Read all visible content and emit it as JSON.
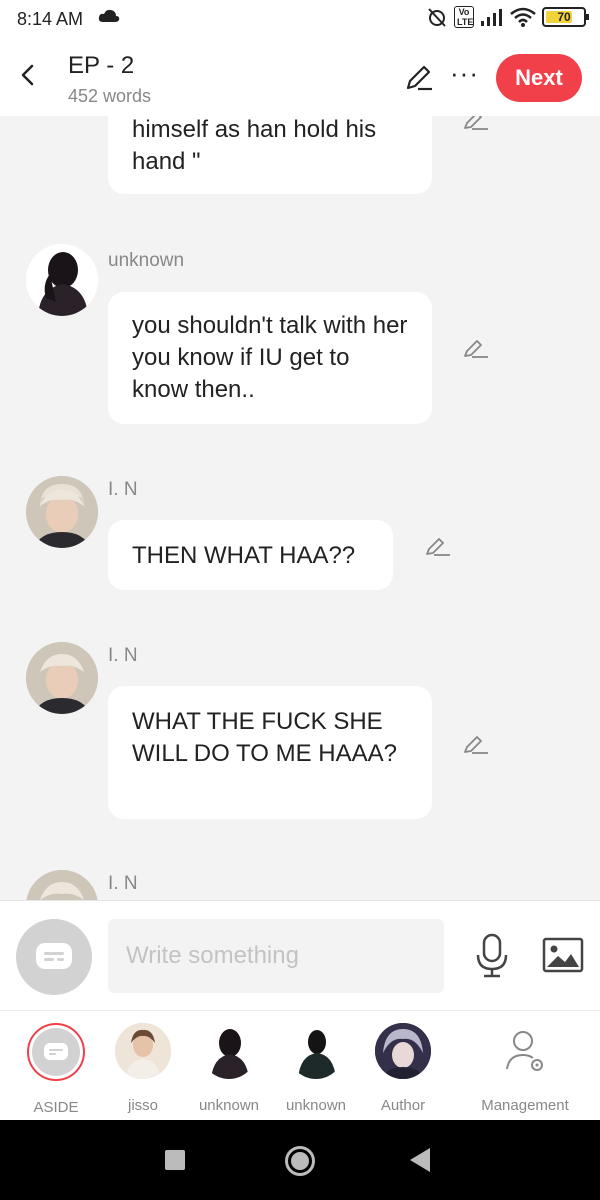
{
  "status_bar": {
    "time": "8:14 AM",
    "volte": "Vo LTE",
    "battery": "70"
  },
  "header": {
    "title": "EP - 2",
    "word_count": "452 words",
    "next_label": "Next",
    "more_label": "···"
  },
  "messages": [
    {
      "sender": "",
      "text": "himself as han hold his hand \""
    },
    {
      "sender": "unknown",
      "text": "you shouldn't talk with her you know if IU get to know then.."
    },
    {
      "sender": "I. N",
      "text": "THEN WHAT HAA??"
    },
    {
      "sender": "I. N",
      "text": "WHAT THE FUCK SHE WILL DO TO ME HAAA?"
    },
    {
      "sender": "I. N",
      "text": ""
    }
  ],
  "input": {
    "placeholder": "Write something"
  },
  "characters": [
    {
      "label": "ASIDE"
    },
    {
      "label": "jisso"
    },
    {
      "label": "unknown"
    },
    {
      "label": "unknown"
    },
    {
      "label": "Author"
    },
    {
      "label": "Management"
    }
  ],
  "colors": {
    "accent": "#f2404b",
    "background": "#f3f3f3",
    "bubble": "#ffffff",
    "muted_text": "#888888"
  }
}
